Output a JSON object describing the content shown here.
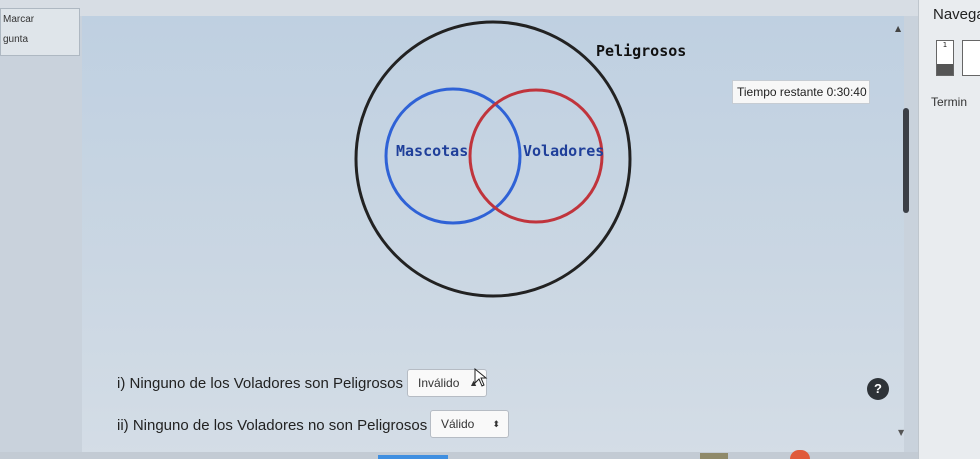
{
  "left_panel": {
    "label1": "Marcar",
    "label2": "gunta"
  },
  "venn": {
    "outer_label": "Peligrosos",
    "left_label": "Mascotas",
    "right_label": "Voladores",
    "colors": {
      "outer": "#222222",
      "left": "#2f62d6",
      "right": "#c0343c"
    }
  },
  "timer": {
    "label": "Tiempo restante 0:30:40"
  },
  "nav": {
    "title": "Navega",
    "question_number": "1",
    "finish_label": "Termin"
  },
  "statements": [
    {
      "text": "i) Ninguno de los Voladores son Peligrosos",
      "selected": "Inválido"
    },
    {
      "text": "ii) Ninguno de los Voladores no son Peligrosos",
      "selected": "Válido"
    }
  ],
  "help": {
    "label": "?"
  }
}
